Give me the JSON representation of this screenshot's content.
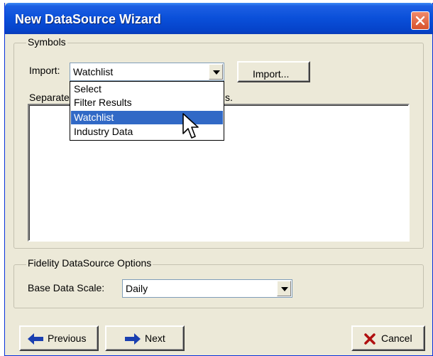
{
  "window": {
    "title": "New DataSource Wizard"
  },
  "symbols": {
    "legend": "Symbols",
    "import_label": "Import:",
    "import_value": "Watchlist",
    "import_button": "Import...",
    "separate_label_left": "Separate",
    "separate_label_right": "s.",
    "dropdown_options": [
      "Select",
      "Filter Results",
      "Watchlist",
      "Industry Data"
    ],
    "selected_index": 2
  },
  "fidelity": {
    "legend": "Fidelity DataSource Options",
    "scale_label": "Base Data Scale:",
    "scale_value": "Daily"
  },
  "buttons": {
    "previous": "Previous",
    "next": "Next",
    "cancel": "Cancel"
  },
  "colors": {
    "title_bar": "#0a4fd9",
    "selection": "#3169c6",
    "arrow_blue": "#1a3fb0",
    "cancel_x": "#b01010"
  }
}
